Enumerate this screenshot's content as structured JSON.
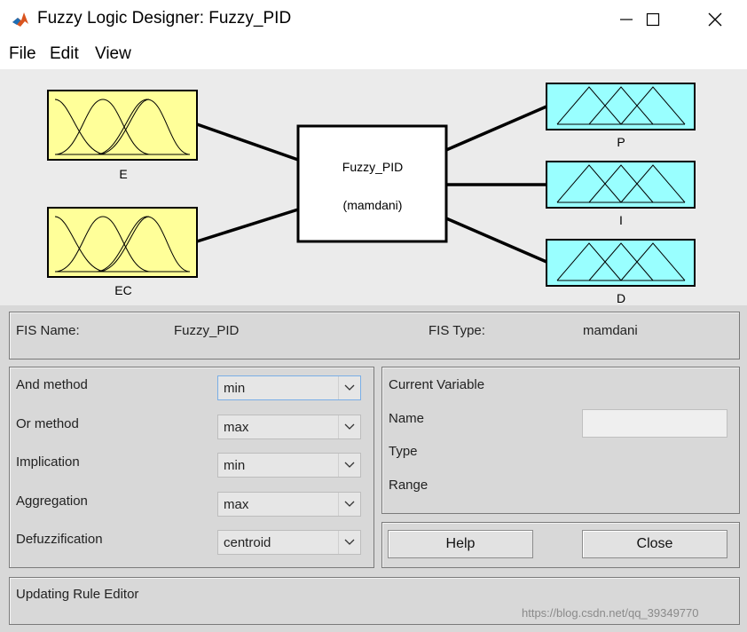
{
  "window": {
    "title": "Fuzzy Logic Designer: Fuzzy_PID",
    "app_icon": "matlab-icon",
    "controls": [
      "minimize-icon",
      "maximize-icon",
      "close-icon"
    ]
  },
  "menu": {
    "items": [
      "File",
      "Edit",
      "View"
    ]
  },
  "diagram": {
    "inputs": [
      {
        "name": "E"
      },
      {
        "name": "EC"
      }
    ],
    "system": {
      "name": "Fuzzy_PID",
      "type": "(mamdani)"
    },
    "outputs": [
      {
        "name": "P"
      },
      {
        "name": "I"
      },
      {
        "name": "D"
      }
    ],
    "colors": {
      "input": "#ffff99",
      "output": "#99ffff",
      "line": "#000000"
    }
  },
  "fis": {
    "name_label": "FIS Name:",
    "name_value": "Fuzzy_PID",
    "type_label": "FIS Type:",
    "type_value": "mamdani"
  },
  "methods": [
    {
      "label": "And method",
      "value": "min"
    },
    {
      "label": "Or method",
      "value": "max"
    },
    {
      "label": "Implication",
      "value": "min"
    },
    {
      "label": "Aggregation",
      "value": "max"
    },
    {
      "label": "Defuzzification",
      "value": "centroid"
    }
  ],
  "current_variable": {
    "title": "Current Variable",
    "name_label": "Name",
    "name_value": "",
    "type_label": "Type",
    "range_label": "Range"
  },
  "buttons": {
    "help": "Help",
    "close": "Close"
  },
  "status": {
    "text": "Updating Rule Editor"
  },
  "watermark": "https://blog.csdn.net/qq_39349770"
}
